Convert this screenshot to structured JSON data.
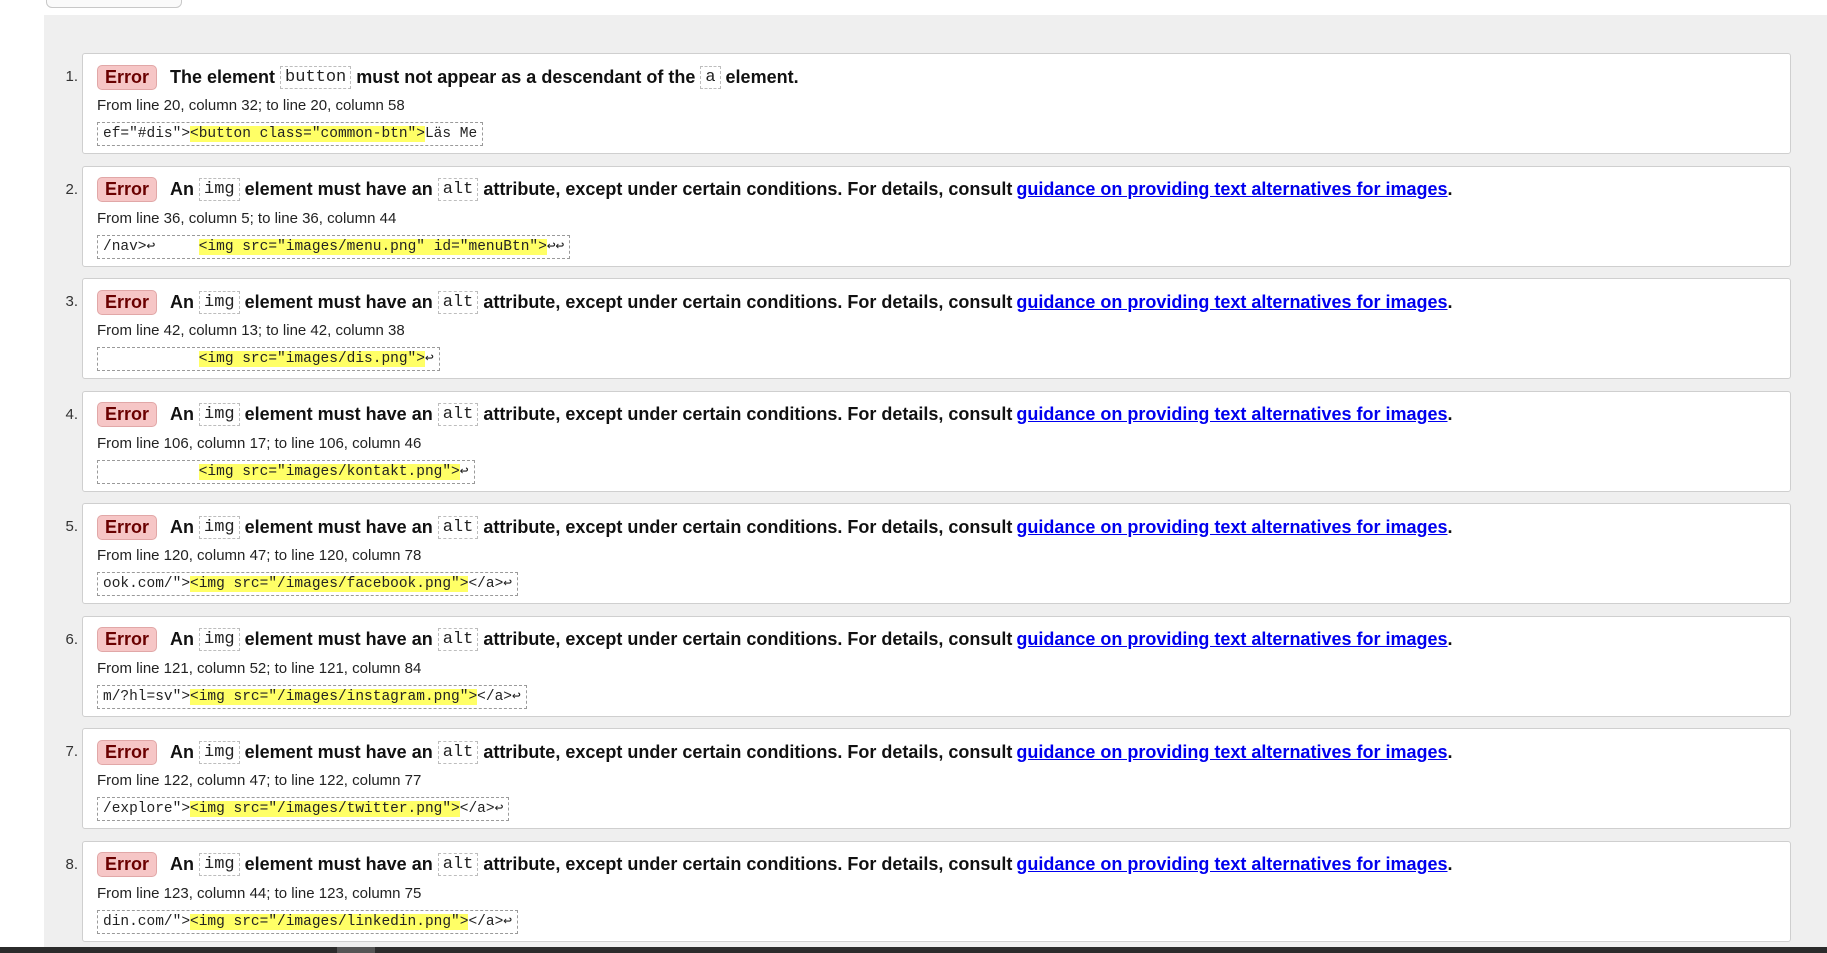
{
  "messages": [
    {
      "num": "1.",
      "badge": "Error",
      "parts": [
        {
          "t": "text",
          "v": "The element"
        },
        {
          "t": "code",
          "v": "button"
        },
        {
          "t": "text",
          "v": "must not appear as a descendant of the"
        },
        {
          "t": "code",
          "v": "a"
        },
        {
          "t": "text",
          "v": "element."
        }
      ],
      "location": "From line 20, column 32; to line 20, column 58",
      "extract": [
        {
          "v": "ef=\"#dis\">",
          "hl": false
        },
        {
          "v": "<button class=\"common-btn\">",
          "hl": true
        },
        {
          "v": "Läs Me",
          "hl": false
        }
      ]
    },
    {
      "num": "2.",
      "badge": "Error",
      "parts": [
        {
          "t": "text",
          "v": "An"
        },
        {
          "t": "code",
          "v": "img"
        },
        {
          "t": "text",
          "v": "element must have an"
        },
        {
          "t": "code",
          "v": "alt"
        },
        {
          "t": "text",
          "v": "attribute, except under certain conditions. For details, consult"
        },
        {
          "t": "link",
          "v": "guidance on providing text alternatives for images"
        },
        {
          "t": "dot",
          "v": "."
        }
      ],
      "location": "From line 36, column 5; to line 36, column 44",
      "extract": [
        {
          "v": "/nav>↩     ",
          "hl": false
        },
        {
          "v": "<img src=\"images/menu.png\" id=\"menuBtn\">",
          "hl": true
        },
        {
          "v": "↩↩",
          "hl": false
        }
      ]
    },
    {
      "num": "3.",
      "badge": "Error",
      "parts": [
        {
          "t": "text",
          "v": "An"
        },
        {
          "t": "code",
          "v": "img"
        },
        {
          "t": "text",
          "v": "element must have an"
        },
        {
          "t": "code",
          "v": "alt"
        },
        {
          "t": "text",
          "v": "attribute, except under certain conditions. For details, consult"
        },
        {
          "t": "link",
          "v": "guidance on providing text alternatives for images"
        },
        {
          "t": "dot",
          "v": "."
        }
      ],
      "location": "From line 42, column 13; to line 42, column 38",
      "extract": [
        {
          "v": "           ",
          "hl": false
        },
        {
          "v": "<img src=\"images/dis.png\">",
          "hl": true
        },
        {
          "v": "↩",
          "hl": false
        }
      ]
    },
    {
      "num": "4.",
      "badge": "Error",
      "parts": [
        {
          "t": "text",
          "v": "An"
        },
        {
          "t": "code",
          "v": "img"
        },
        {
          "t": "text",
          "v": "element must have an"
        },
        {
          "t": "code",
          "v": "alt"
        },
        {
          "t": "text",
          "v": "attribute, except under certain conditions. For details, consult"
        },
        {
          "t": "link",
          "v": "guidance on providing text alternatives for images"
        },
        {
          "t": "dot",
          "v": "."
        }
      ],
      "location": "From line 106, column 17; to line 106, column 46",
      "extract": [
        {
          "v": "           ",
          "hl": false
        },
        {
          "v": "<img src=\"images/kontakt.png\">",
          "hl": true
        },
        {
          "v": "↩",
          "hl": false
        }
      ]
    },
    {
      "num": "5.",
      "badge": "Error",
      "parts": [
        {
          "t": "text",
          "v": "An"
        },
        {
          "t": "code",
          "v": "img"
        },
        {
          "t": "text",
          "v": "element must have an"
        },
        {
          "t": "code",
          "v": "alt"
        },
        {
          "t": "text",
          "v": "attribute, except under certain conditions. For details, consult"
        },
        {
          "t": "link",
          "v": "guidance on providing text alternatives for images"
        },
        {
          "t": "dot",
          "v": "."
        }
      ],
      "location": "From line 120, column 47; to line 120, column 78",
      "extract": [
        {
          "v": "ook.com/\">",
          "hl": false
        },
        {
          "v": "<img src=\"/images/facebook.png\">",
          "hl": true
        },
        {
          "v": "</a>↩",
          "hl": false
        }
      ]
    },
    {
      "num": "6.",
      "badge": "Error",
      "parts": [
        {
          "t": "text",
          "v": "An"
        },
        {
          "t": "code",
          "v": "img"
        },
        {
          "t": "text",
          "v": "element must have an"
        },
        {
          "t": "code",
          "v": "alt"
        },
        {
          "t": "text",
          "v": "attribute, except under certain conditions. For details, consult"
        },
        {
          "t": "link",
          "v": "guidance on providing text alternatives for images"
        },
        {
          "t": "dot",
          "v": "."
        }
      ],
      "location": "From line 121, column 52; to line 121, column 84",
      "extract": [
        {
          "v": "m/?hl=sv\">",
          "hl": false
        },
        {
          "v": "<img src=\"/images/instagram.png\">",
          "hl": true
        },
        {
          "v": "</a>↩",
          "hl": false
        }
      ]
    },
    {
      "num": "7.",
      "badge": "Error",
      "parts": [
        {
          "t": "text",
          "v": "An"
        },
        {
          "t": "code",
          "v": "img"
        },
        {
          "t": "text",
          "v": "element must have an"
        },
        {
          "t": "code",
          "v": "alt"
        },
        {
          "t": "text",
          "v": "attribute, except under certain conditions. For details, consult"
        },
        {
          "t": "link",
          "v": "guidance on providing text alternatives for images"
        },
        {
          "t": "dot",
          "v": "."
        }
      ],
      "location": "From line 122, column 47; to line 122, column 77",
      "extract": [
        {
          "v": "/explore\">",
          "hl": false
        },
        {
          "v": "<img src=\"/images/twitter.png\">",
          "hl": true
        },
        {
          "v": "</a>↩",
          "hl": false
        }
      ]
    },
    {
      "num": "8.",
      "badge": "Error",
      "parts": [
        {
          "t": "text",
          "v": "An"
        },
        {
          "t": "code",
          "v": "img"
        },
        {
          "t": "text",
          "v": "element must have an"
        },
        {
          "t": "code",
          "v": "alt"
        },
        {
          "t": "text",
          "v": "attribute, except under certain conditions. For details, consult"
        },
        {
          "t": "link",
          "v": "guidance on providing text alternatives for images"
        },
        {
          "t": "dot",
          "v": "."
        }
      ],
      "location": "From line 123, column 44; to line 123, column 75",
      "extract": [
        {
          "v": "din.com/\">",
          "hl": false
        },
        {
          "v": "<img src=\"/images/linkedin.png\">",
          "hl": true
        },
        {
          "v": "</a>↩",
          "hl": false
        }
      ]
    }
  ]
}
